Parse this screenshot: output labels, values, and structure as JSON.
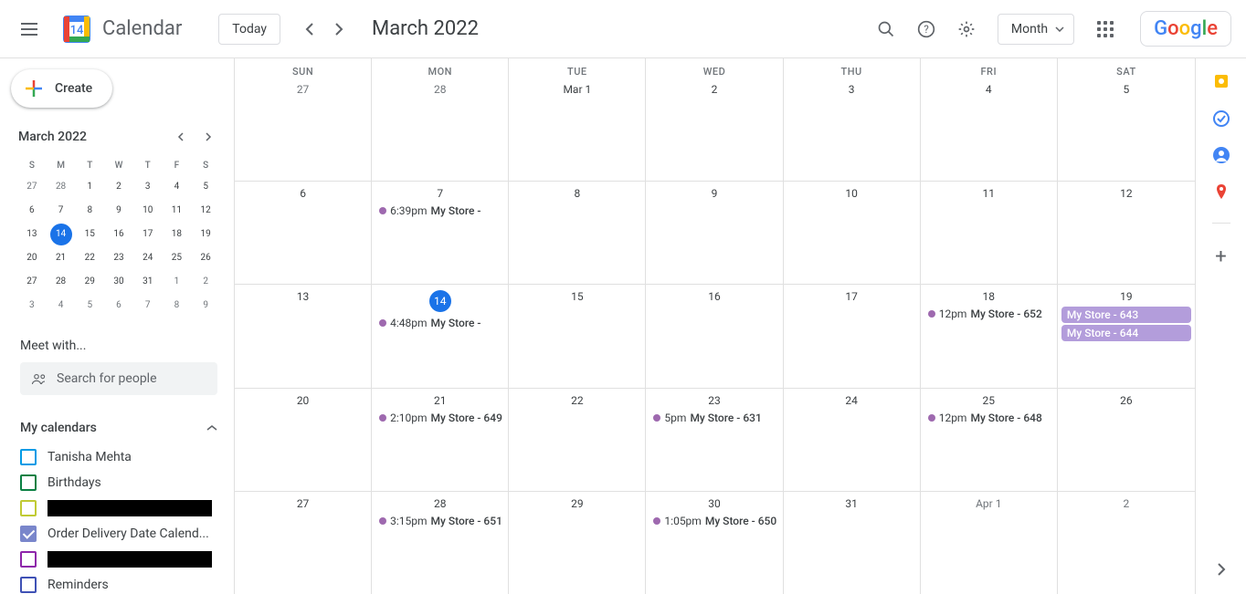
{
  "app_title": "Calendar",
  "today_label": "Today",
  "month_title": "March 2022",
  "view_label": "Month",
  "google_letters": [
    "G",
    "o",
    "o",
    "g",
    "l",
    "e"
  ],
  "mini": {
    "title": "March 2022",
    "dow": [
      "S",
      "M",
      "T",
      "W",
      "T",
      "F",
      "S"
    ],
    "days": [
      [
        "27",
        "28",
        "1",
        "2",
        "3",
        "4",
        "5"
      ],
      [
        "6",
        "7",
        "8",
        "9",
        "10",
        "11",
        "12"
      ],
      [
        "13",
        "14",
        "15",
        "16",
        "17",
        "18",
        "19"
      ],
      [
        "20",
        "21",
        "22",
        "23",
        "24",
        "25",
        "26"
      ],
      [
        "27",
        "28",
        "29",
        "30",
        "31",
        "1",
        "2"
      ],
      [
        "3",
        "4",
        "5",
        "6",
        "7",
        "8",
        "9"
      ]
    ],
    "out_first": 2,
    "out_last": 9,
    "today": "14"
  },
  "meet_label": "Meet with...",
  "search_placeholder": "Search for people",
  "mycal_label": "My calendars",
  "calendars": [
    {
      "name": "Tanisha Mehta",
      "color": "#039be5",
      "checked": false
    },
    {
      "name": "Birthdays",
      "color": "#0b8043",
      "checked": false
    },
    {
      "name": "",
      "color": "#c0ca33",
      "checked": false,
      "redacted": true
    },
    {
      "name": "Order Delivery Date Calend...",
      "color": "#7986cb",
      "checked": true
    },
    {
      "name": "",
      "color": "#8e24aa",
      "checked": false,
      "redacted": true
    },
    {
      "name": "Reminders",
      "color": "#3f51b5",
      "checked": false
    }
  ],
  "grid": {
    "dow": [
      "SUN",
      "MON",
      "TUE",
      "WED",
      "THU",
      "FRI",
      "SAT"
    ],
    "weeks": [
      [
        {
          "num": "27",
          "out": true
        },
        {
          "num": "28",
          "out": true
        },
        {
          "num": "Mar 1"
        },
        {
          "num": "2"
        },
        {
          "num": "3"
        },
        {
          "num": "4"
        },
        {
          "num": "5"
        }
      ],
      [
        {
          "num": "6"
        },
        {
          "num": "7",
          "events": [
            {
              "time": "6:39pm",
              "title": "My Store -"
            }
          ]
        },
        {
          "num": "8"
        },
        {
          "num": "9"
        },
        {
          "num": "10"
        },
        {
          "num": "11"
        },
        {
          "num": "12"
        }
      ],
      [
        {
          "num": "13"
        },
        {
          "num": "14",
          "today": true,
          "events": [
            {
              "time": "4:48pm",
              "title": "My Store -"
            }
          ]
        },
        {
          "num": "15"
        },
        {
          "num": "16"
        },
        {
          "num": "17"
        },
        {
          "num": "18",
          "events": [
            {
              "time": "12pm",
              "title": "My Store - 652"
            }
          ]
        },
        {
          "num": "19",
          "events": [
            {
              "allday": true,
              "title": "My Store - 643"
            },
            {
              "allday": true,
              "title": "My Store - 644"
            }
          ]
        }
      ],
      [
        {
          "num": "20"
        },
        {
          "num": "21",
          "events": [
            {
              "time": "2:10pm",
              "title": "My Store - 649"
            }
          ]
        },
        {
          "num": "22"
        },
        {
          "num": "23",
          "events": [
            {
              "time": "5pm",
              "title": "My Store - 631"
            }
          ]
        },
        {
          "num": "24"
        },
        {
          "num": "25",
          "events": [
            {
              "time": "12pm",
              "title": "My Store - 648"
            }
          ]
        },
        {
          "num": "26"
        }
      ],
      [
        {
          "num": "27"
        },
        {
          "num": "28",
          "events": [
            {
              "time": "3:15pm",
              "title": "My Store - 651"
            }
          ]
        },
        {
          "num": "29"
        },
        {
          "num": "30",
          "events": [
            {
              "time": "1:05pm",
              "title": "My Store - 650"
            }
          ]
        },
        {
          "num": "31"
        },
        {
          "num": "Apr 1",
          "out": true
        },
        {
          "num": "2",
          "out": true
        }
      ]
    ]
  },
  "create_label": "Create"
}
